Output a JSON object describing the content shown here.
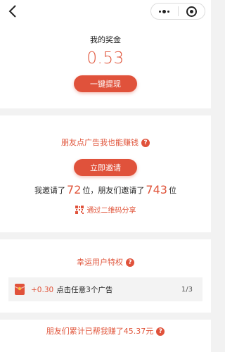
{
  "topbar": {},
  "reward": {
    "title": "我的奖金",
    "amount": "0.53",
    "withdraw_label": "一键提现"
  },
  "invite": {
    "title": "朋友点广告我也能赚钱",
    "invite_label": "立即邀请",
    "stats_prefix": "我邀请了",
    "my_count": "72",
    "stats_mid": "位，朋友们邀请了",
    "friends_count": "743",
    "stats_suffix": "位",
    "qr_share_label": "通过二维码分享"
  },
  "privilege": {
    "title": "幸运用户特权",
    "task_bonus": "+0.30",
    "task_label": "点击任意3个广告",
    "task_progress": "1/3"
  },
  "footer_banner": {
    "title": "朋友们累计已帮我赚了45.37元"
  },
  "colors": {
    "accent": "#e0523b"
  }
}
